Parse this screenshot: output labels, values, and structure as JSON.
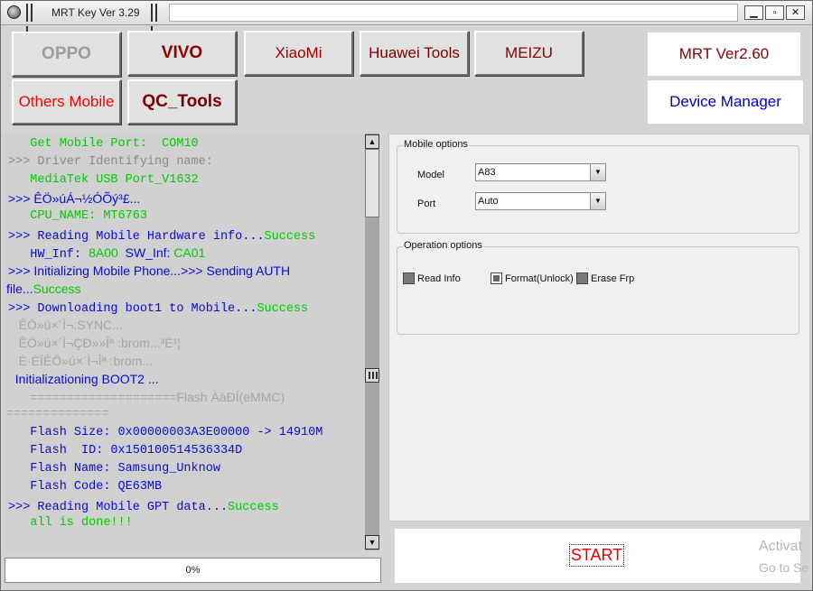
{
  "window": {
    "title": "MRT Key Ver 3.29",
    "controls": {
      "minimize": "▁",
      "restore": "▫",
      "close": "✕"
    }
  },
  "brands": {
    "oppo": "OPPO",
    "vivo": "VIVO",
    "xiaomi": "XiaoMi",
    "huawei": "Huawei Tools",
    "meizu": "MEIZU",
    "others": "Others Mobile",
    "qc_tools": "QC_Tools"
  },
  "version_label": "MRT Ver2.60",
  "device_manager_label": "Device Manager",
  "log": {
    "l1": "   Get Mobile Port:  COM10",
    "l2": ">>> Driver Identifying name:",
    "l3": "   MediaTek USB Port_V1632",
    "l4": ">>> ÊÖ»úÁ¬½ÓÕý³£...",
    "l5": "   CPU_NAME: MT6763",
    "l6a": ">>> Reading Mobile Hardware info...",
    "l6b": "Success",
    "l7a": "   HW_Inf: ",
    "l7b": "8A00",
    "l7c": "  SW_Inf: ",
    "l7d": "CA01",
    "l8": ">>> Initializing Mobile Phone...>>> Sending AUTH",
    "l9a": "file...",
    "l9b": "Success",
    "l10a": ">>> Downloading boot1 to Mobile...",
    "l10b": "Success",
    "l11": "   ÊÖ»ú×´Ì¬:SYNC...",
    "l12": "   ÊÖ»ú×´Ì¬ÇÐ»»Îª :brom...³É¹¦",
    "l13": "   È·ÈÏÊÖ»ú×´Ì¬Îª :brom...",
    "l14": "  Initializationing BOOT2 ...",
    "l15a": "   ====================",
    "l15b": "Flash ÀàÐÍ(eMMC)",
    "l16": "==============",
    "l17": "   Flash Size: 0x00000003A3E00000 -> 14910M",
    "l18": "   Flash  ID: 0x150100514536334D",
    "l19": "   Flash Name: Samsung_Unknow",
    "l20": "   Flash Code: QE63MB",
    "l21a": ">>> Reading Mobile GPT data...",
    "l21b": "Success",
    "l22": "   all is done!!!"
  },
  "progress": {
    "text": "0%",
    "value": 0
  },
  "mobile_options": {
    "title": "Mobile options",
    "model_label": "Model",
    "model_value": "A83",
    "port_label": "Port",
    "port_value": "Auto"
  },
  "operation_options": {
    "title": "Operation options",
    "read_info": {
      "label": "Read Info",
      "checked": false
    },
    "format_unlock": {
      "label": "Format(Unlock)",
      "checked": true
    },
    "erase_frp": {
      "label": "Erase Frp",
      "checked": false
    }
  },
  "start_label": "START",
  "watermark": {
    "line1": "Activat",
    "line2": "Go to Se"
  },
  "colors": {
    "log_green": "#00cc00",
    "log_blue": "#0a0ad6",
    "log_grey": "#8a8a8a",
    "start_red": "#e00000",
    "brand_red": "#8b0000"
  }
}
